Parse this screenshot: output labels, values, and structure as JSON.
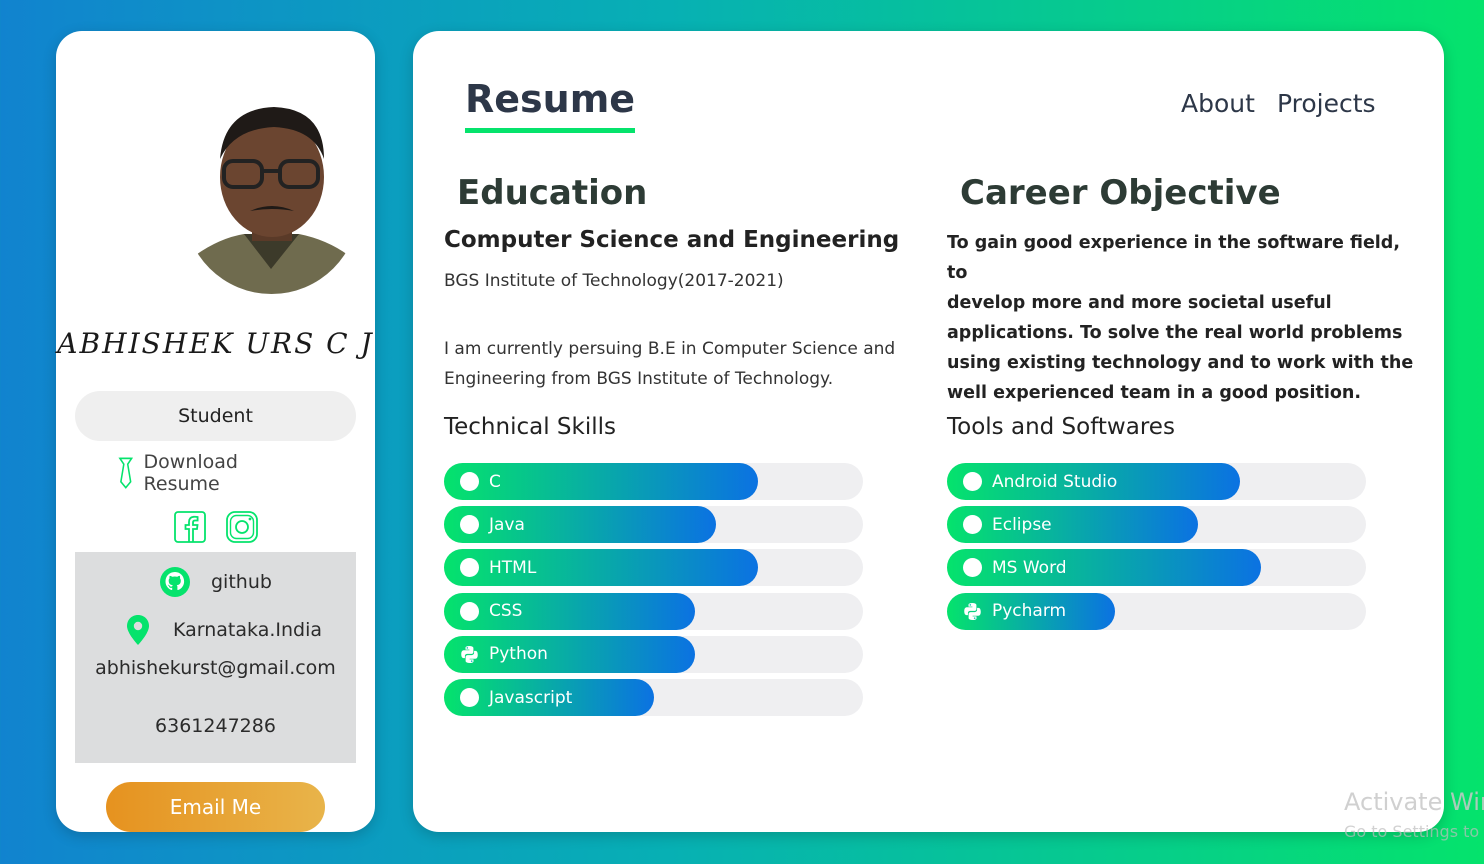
{
  "profile": {
    "name": "ABHISHEK URS C J",
    "role": "Student",
    "download_label": "Download Resume",
    "github_label": "github",
    "location": "Karnataka.India",
    "email": "abhishekurst@gmail.com",
    "phone": "6361247286",
    "email_button": "Email Me",
    "social_icons": [
      "facebook-icon",
      "instagram-icon"
    ]
  },
  "header": {
    "title": "Resume",
    "nav": [
      "About",
      "Projects"
    ]
  },
  "education": {
    "heading": "Education",
    "degree": "Computer Science and Engineering",
    "institute": "BGS Institute of Technology(2017-2021)",
    "description_line1": "I am currently persuing B.E in Computer Science and",
    "description_line2": "Engineering from BGS Institute of Technology."
  },
  "career": {
    "heading": "Career Objective",
    "lines": [
      "To gain good experience in the software field, to",
      "develop more and more societal useful",
      "applications. To solve the real world problems",
      "using existing technology and to work with the",
      "well experienced team in a good position."
    ]
  },
  "technical_skills": {
    "heading": "Technical Skills",
    "items": [
      {
        "label": "C",
        "level": 0.75,
        "icon": "dot"
      },
      {
        "label": "Java",
        "level": 0.65,
        "icon": "dot"
      },
      {
        "label": "HTML",
        "level": 0.75,
        "icon": "dot"
      },
      {
        "label": "CSS",
        "level": 0.6,
        "icon": "dot"
      },
      {
        "label": "Python",
        "level": 0.6,
        "icon": "python-icon"
      },
      {
        "label": "Javascript",
        "level": 0.5,
        "icon": "dot"
      }
    ]
  },
  "tools": {
    "heading": "Tools and Softwares",
    "items": [
      {
        "label": "Android Studio",
        "level": 0.7,
        "icon": "dot"
      },
      {
        "label": "Eclipse",
        "level": 0.6,
        "icon": "dot"
      },
      {
        "label": "MS Word",
        "level": 0.75,
        "icon": "dot"
      },
      {
        "label": "Pycharm",
        "level": 0.4,
        "icon": "python-icon"
      }
    ]
  },
  "watermark": {
    "line1": "Activate Win",
    "line2": "Go to Settings to"
  },
  "colors": {
    "accent_green": "#05e36c",
    "accent_blue": "#0b72e2",
    "button_orange": "#e6921f"
  }
}
